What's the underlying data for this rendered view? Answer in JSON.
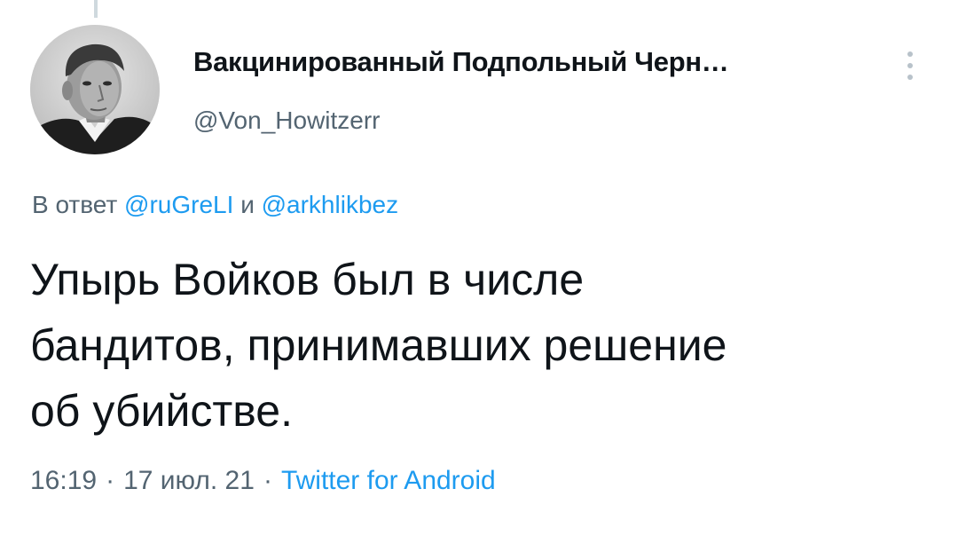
{
  "author": {
    "display_name": "Вакцинированный Подпольный Черн…",
    "handle": "@Von_Howitzerr"
  },
  "icons": {
    "more": "more-vertical-icon",
    "avatar": "profile-photo"
  },
  "reply": {
    "prefix": "В ответ",
    "mention_1": "@ruGreLI",
    "joiner": "и",
    "mention_2": "@arkhlikbez"
  },
  "tweet": {
    "lines": [
      "Упырь Войков был в числе",
      "бандитов, принимавших решение",
      "об убийстве."
    ]
  },
  "meta": {
    "time": "16:19",
    "separator": "·",
    "date": "17 июл. 21",
    "source": "Twitter for Android"
  },
  "colors": {
    "text": "#0f1419",
    "secondary": "#536471",
    "link": "#1d9bf0"
  }
}
